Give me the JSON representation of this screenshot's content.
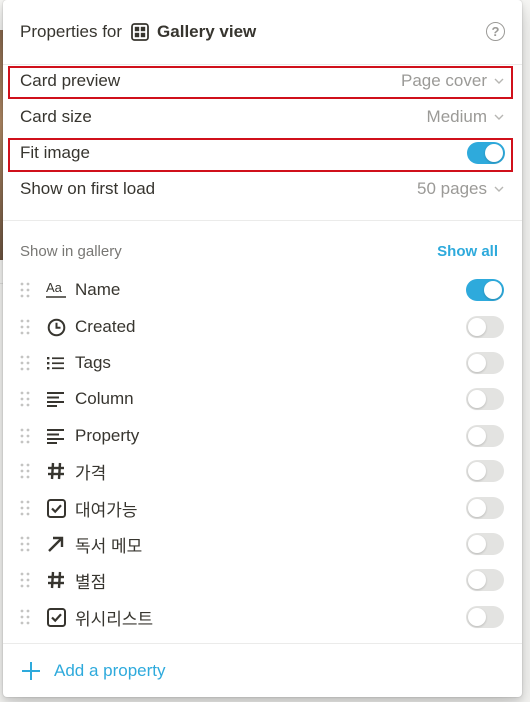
{
  "header": {
    "prefix": "Properties for",
    "view_icon": "gallery-grid-icon",
    "view_name": "Gallery view",
    "help_icon": "question-circle-icon"
  },
  "settings": [
    {
      "label": "Card preview",
      "value": "Page cover",
      "control": "dropdown",
      "highlighted": true
    },
    {
      "label": "Card size",
      "value": "Medium",
      "control": "dropdown",
      "highlighted": false
    },
    {
      "label": "Fit image",
      "control": "toggle",
      "on": true,
      "highlighted": true
    },
    {
      "label": "Show on first load",
      "value": "50 pages",
      "control": "dropdown",
      "highlighted": false
    }
  ],
  "gallery_section": {
    "title": "Show in gallery",
    "show_all": "Show all"
  },
  "properties": [
    {
      "icon": "text-aa-icon",
      "name": "Name",
      "on": true
    },
    {
      "icon": "clock-icon",
      "name": "Created",
      "on": false
    },
    {
      "icon": "list-icon",
      "name": "Tags",
      "on": false
    },
    {
      "icon": "text-lines-icon",
      "name": "Column",
      "on": false
    },
    {
      "icon": "text-lines-icon",
      "name": "Property",
      "on": false
    },
    {
      "icon": "hash-icon",
      "name": "가격",
      "on": false
    },
    {
      "icon": "checkbox-icon",
      "name": "대여가능",
      "on": false
    },
    {
      "icon": "arrow-up-right-icon",
      "name": "독서 메모",
      "on": false
    },
    {
      "icon": "hash-icon",
      "name": "별점",
      "on": false
    },
    {
      "icon": "checkbox-icon",
      "name": "위시리스트",
      "on": false
    }
  ],
  "footer": {
    "add_property": "Add a property"
  },
  "colors": {
    "accent": "#2eaadc",
    "highlight_box": "#d0101b",
    "toggle_off": "#e3e3e1",
    "muted_text": "#9b9a97"
  }
}
